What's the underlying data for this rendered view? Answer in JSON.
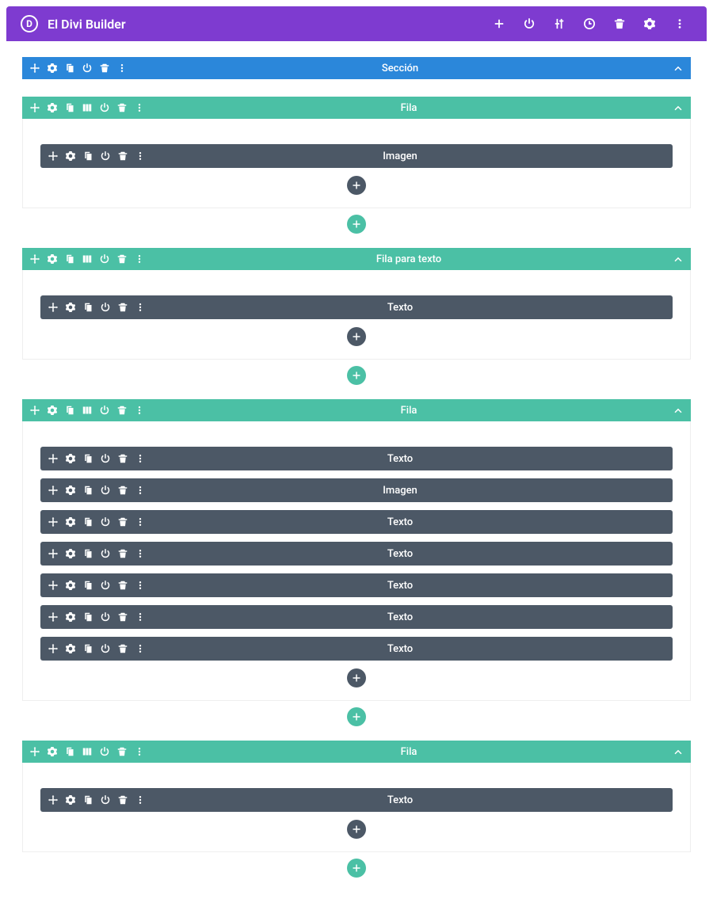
{
  "header": {
    "title": "El Divi Builder"
  },
  "section": {
    "label": "Sección",
    "rows": [
      {
        "label": "Fila",
        "modules": [
          {
            "label": "Imagen"
          }
        ]
      },
      {
        "label": "Fila para texto",
        "modules": [
          {
            "label": "Texto"
          }
        ]
      },
      {
        "label": "Fila",
        "modules": [
          {
            "label": "Texto"
          },
          {
            "label": "Imagen"
          },
          {
            "label": "Texto"
          },
          {
            "label": "Texto"
          },
          {
            "label": "Texto"
          },
          {
            "label": "Texto"
          },
          {
            "label": "Texto"
          }
        ]
      },
      {
        "label": "Fila",
        "modules": [
          {
            "label": "Texto"
          }
        ]
      }
    ]
  },
  "colors": {
    "header_bg": "#7e3bd0",
    "section_bg": "#2b87da",
    "row_bg": "#4bc0a5",
    "module_bg": "#4c5866"
  }
}
